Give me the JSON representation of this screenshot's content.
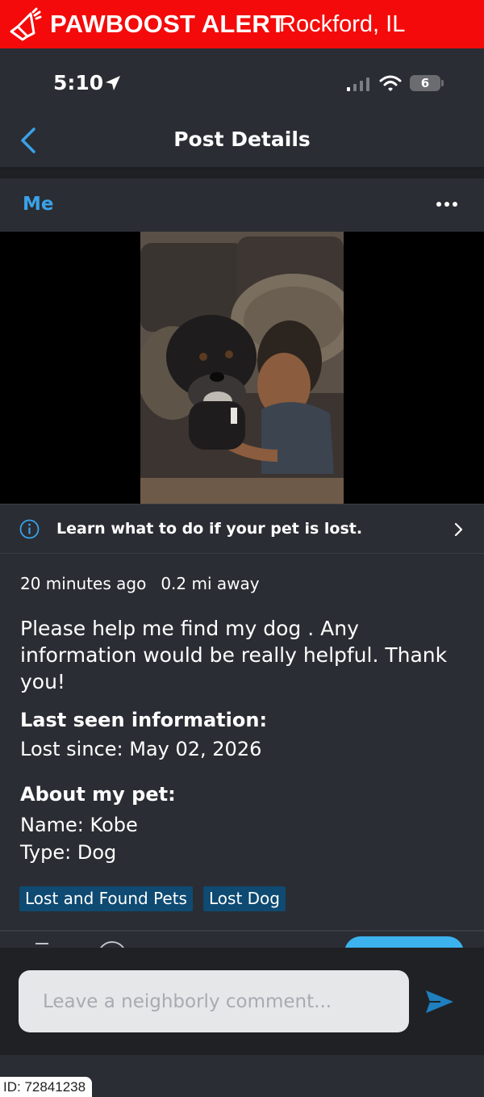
{
  "banner": {
    "brand": "PAWBOOST ALERT",
    "location": "Rockford, IL",
    "icon": "megaphone-icon",
    "color": "#f40a0a"
  },
  "status_bar": {
    "time": "5:10",
    "battery": "6",
    "icons": [
      "location-arrow-icon",
      "signal-icon",
      "wifi-icon",
      "battery-icon"
    ]
  },
  "nav": {
    "title": "Post Details",
    "back_icon": "chevron-left-icon"
  },
  "post": {
    "author": "Me",
    "more_icon": "ellipsis-icon",
    "photo_alt": "Photo of a black dog with a boy on a couch",
    "info_banner": "Learn what to do if your pet is lost.",
    "posted": "20 minutes ago",
    "distance": "0.2 mi away",
    "description": "Please help me find my dog . Any information would be really helpful. Thank you!",
    "last_seen_title": "Last seen information:",
    "lost_since": "Lost since: May 02, 2026",
    "about_title": "About my pet:",
    "pet_name": "Name: Kobe",
    "pet_type": "Type: Dog",
    "tags": [
      "Lost and Found Pets",
      "Lost Dog"
    ]
  },
  "comment": {
    "placeholder": "Leave a neighborly comment...",
    "send_icon": "send-icon"
  },
  "footer": {
    "id_label": "ID: 72841238"
  },
  "colors": {
    "accent_blue": "#3aa2e8",
    "tag_bg": "#0e4a72",
    "background": "#2a2d33"
  }
}
